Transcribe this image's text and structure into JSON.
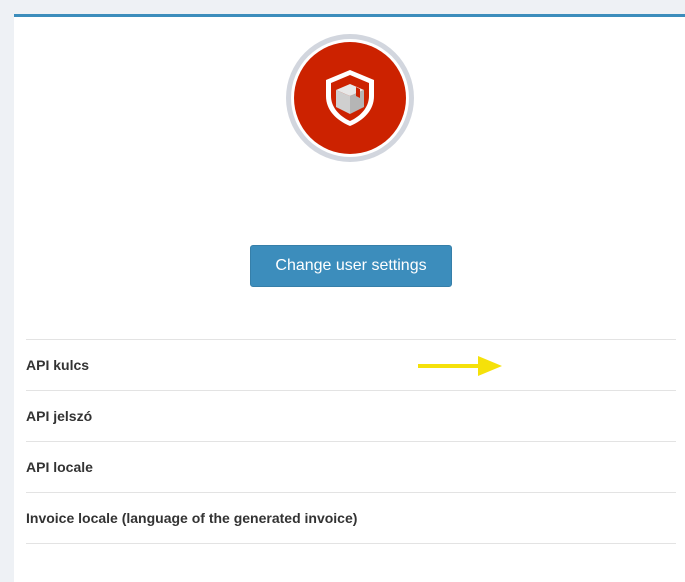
{
  "colors": {
    "accent": "#3c8dbc",
    "button": "#3c8dbc",
    "logo_red": "#cc2200",
    "arrow": "#f5e10a"
  },
  "logo": {
    "icon": "package-box-icon"
  },
  "actions": {
    "change_settings_label": "Change user settings"
  },
  "settings": {
    "rows": [
      {
        "label": "API kulcs"
      },
      {
        "label": "API jelszó"
      },
      {
        "label": "API locale"
      },
      {
        "label": "Invoice locale (language of the generated invoice)"
      }
    ]
  },
  "annotation": {
    "icon": "arrow-right-icon"
  }
}
